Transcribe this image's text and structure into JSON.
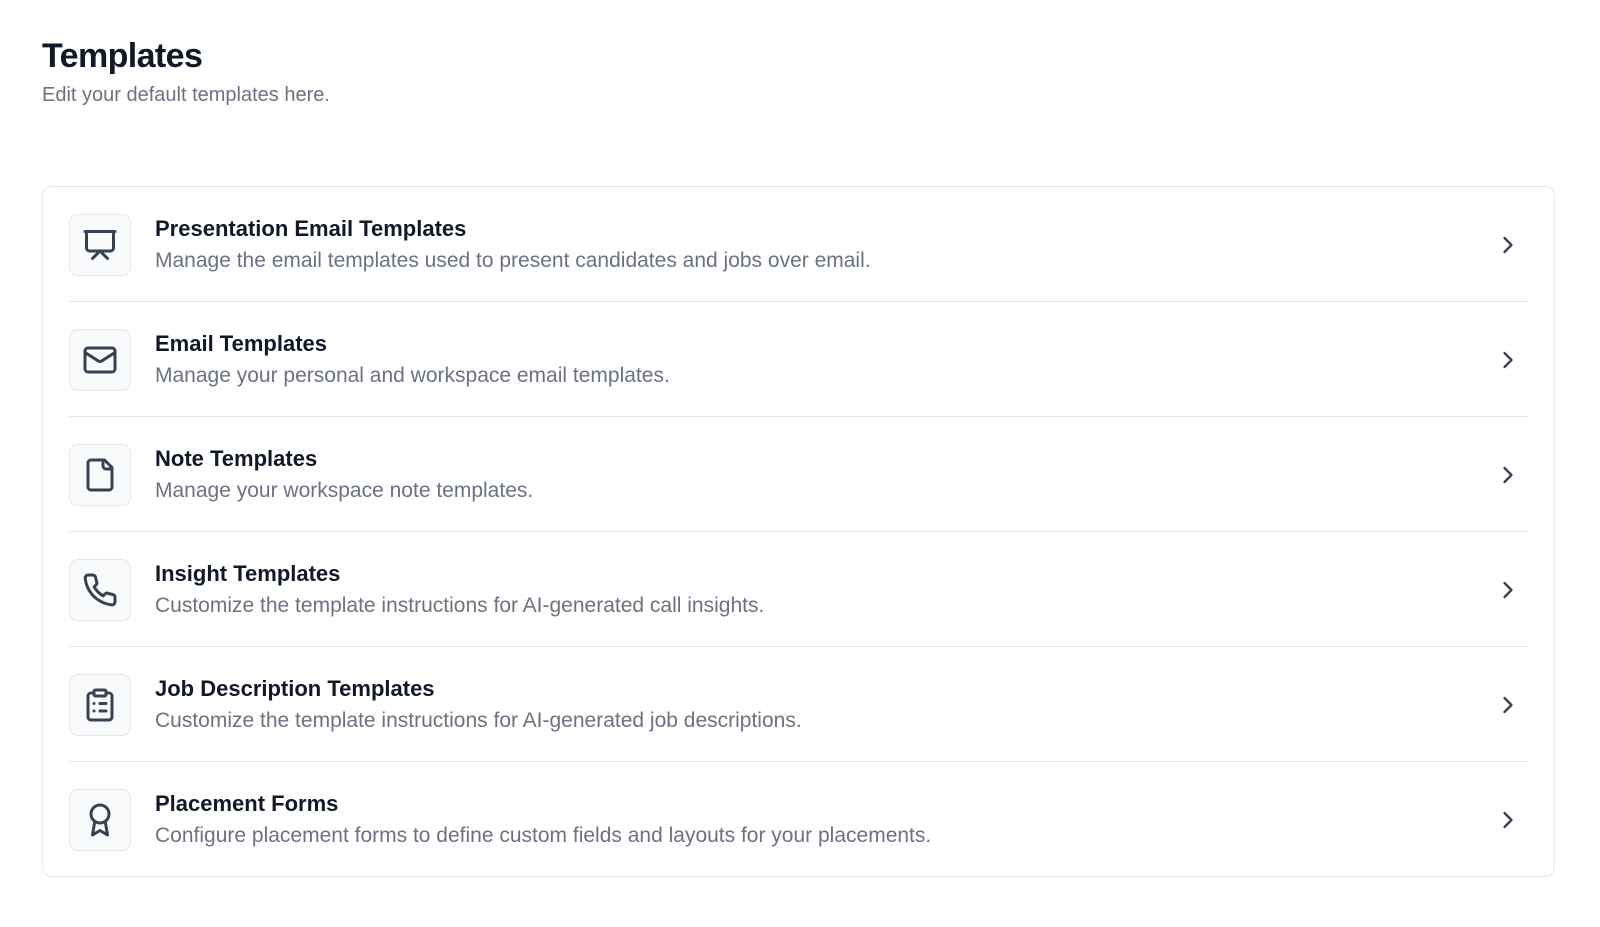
{
  "header": {
    "title": "Templates",
    "subtitle": "Edit your default templates here."
  },
  "items": [
    {
      "title": "Presentation Email Templates",
      "description": "Manage the email templates used to present candidates and jobs over email.",
      "icon": "presentation-icon"
    },
    {
      "title": "Email Templates",
      "description": "Manage your personal and workspace email templates.",
      "icon": "mail-icon"
    },
    {
      "title": "Note Templates",
      "description": "Manage your workspace note templates.",
      "icon": "file-icon"
    },
    {
      "title": "Insight Templates",
      "description": "Customize the template instructions for AI-generated call insights.",
      "icon": "phone-icon"
    },
    {
      "title": "Job Description Templates",
      "description": "Customize the template instructions for AI-generated job descriptions.",
      "icon": "clipboard-list-icon"
    },
    {
      "title": "Placement Forms",
      "description": "Configure placement forms to define custom fields and layouts for your placements.",
      "icon": "award-icon"
    }
  ]
}
